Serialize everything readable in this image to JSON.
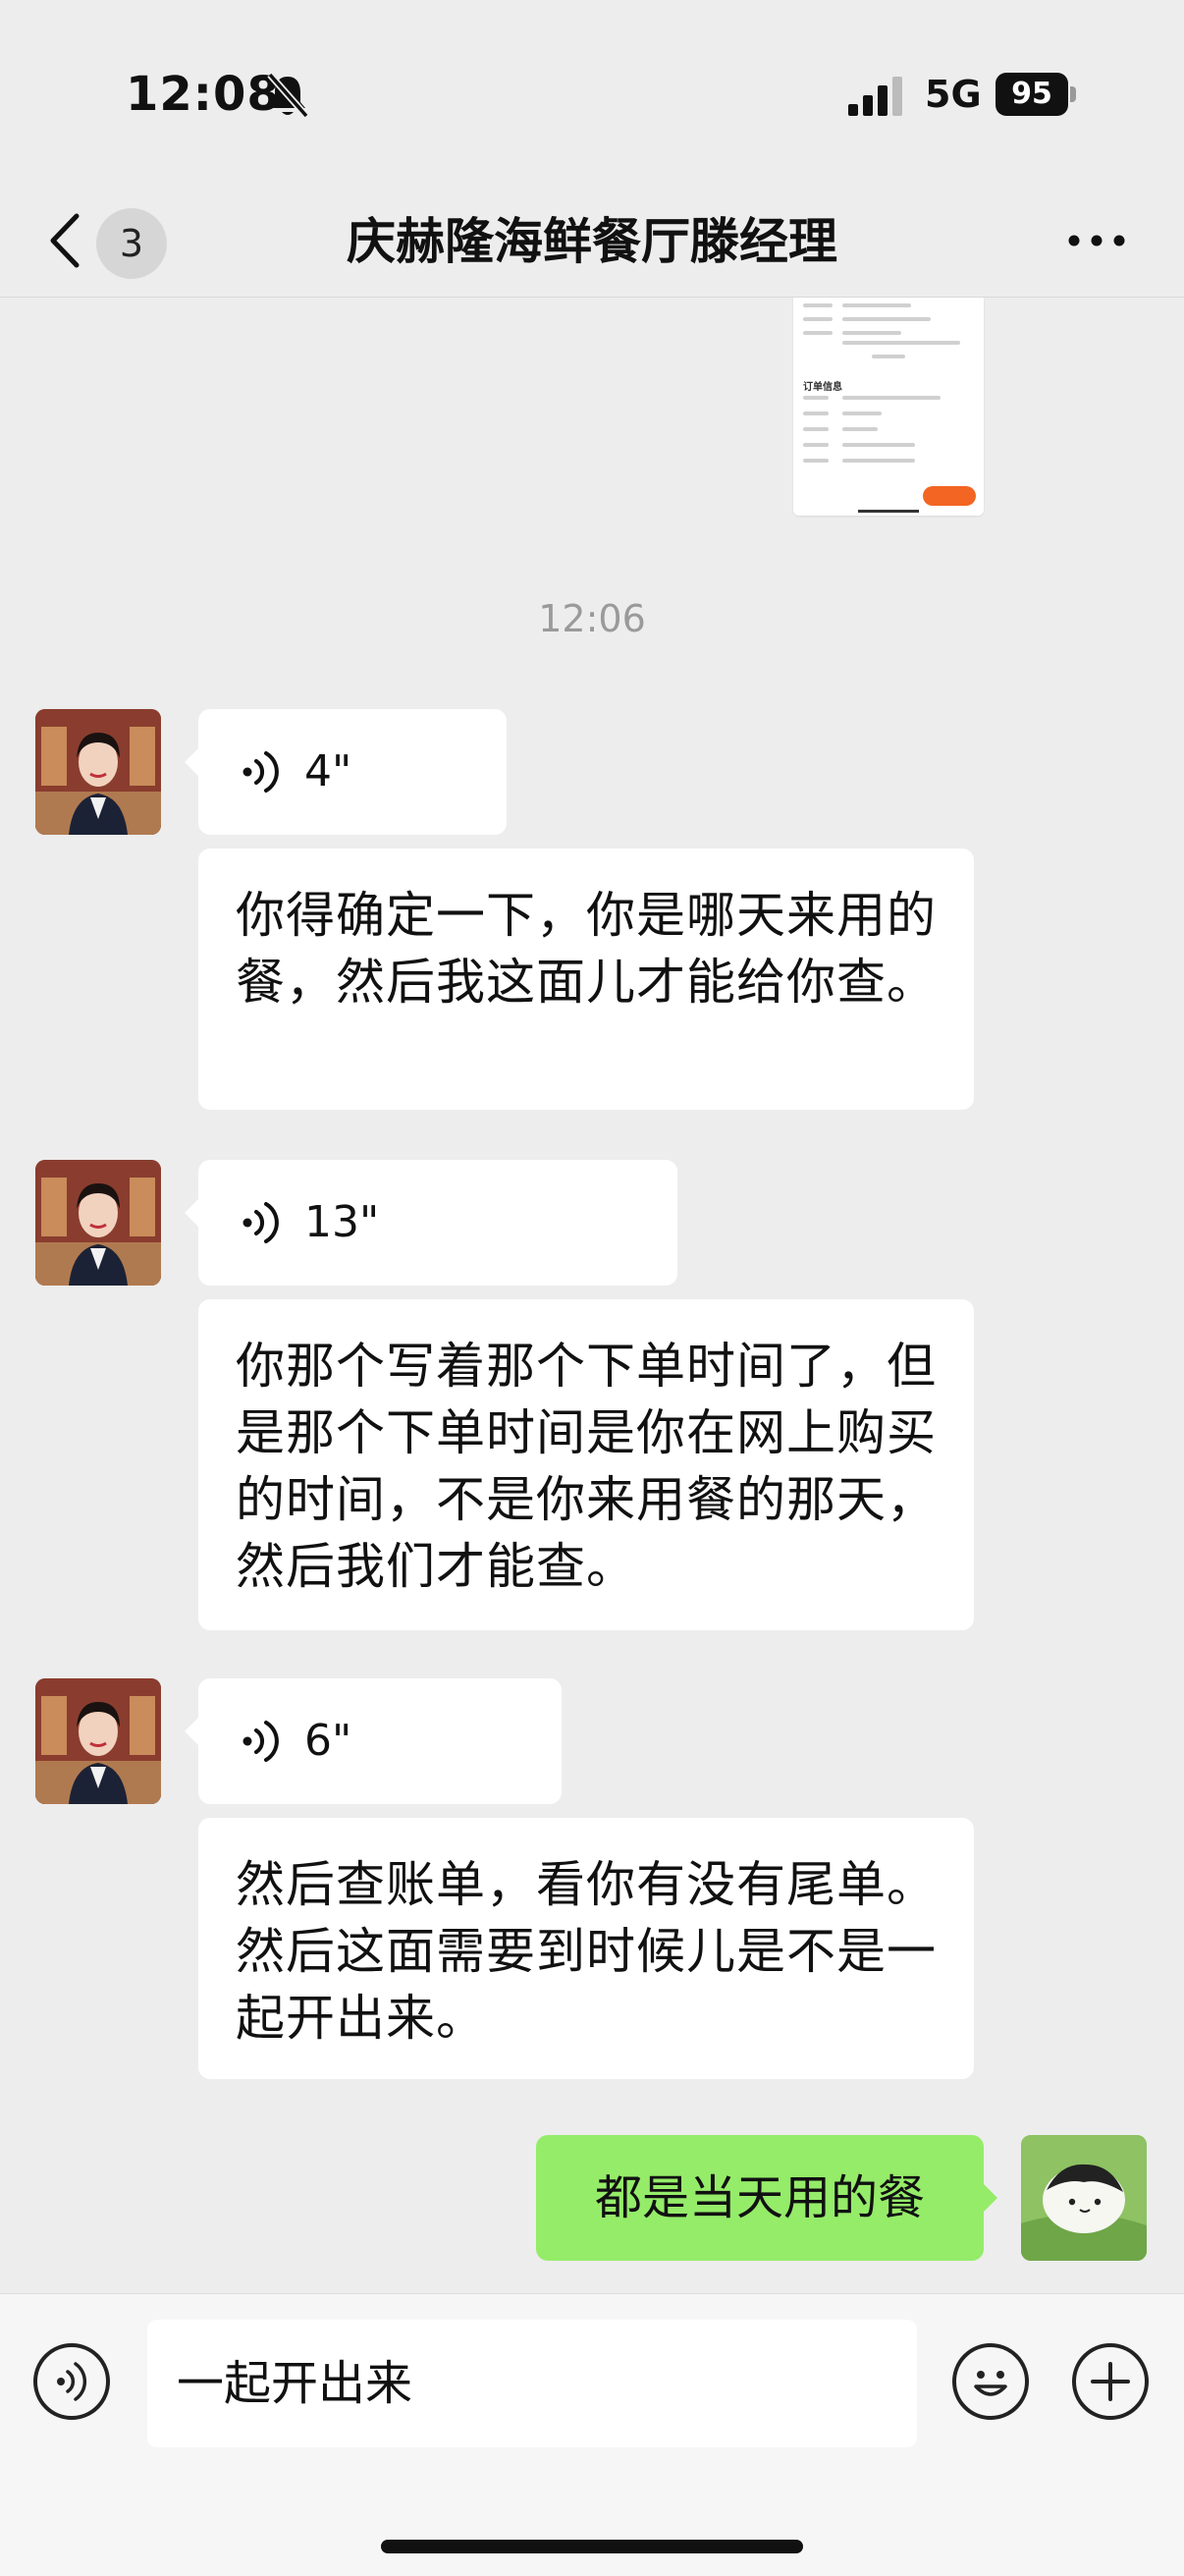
{
  "status_bar": {
    "time": "12:08",
    "network": "5G",
    "battery": "95"
  },
  "nav": {
    "unread_count": "3",
    "title": "庆赫隆海鲜餐厅滕经理"
  },
  "chat": {
    "timestamp": "12:06",
    "messages": [
      {
        "voice_duration": "4\"",
        "transcript": "你得确定一下，你是哪天来用的餐，然后我这面儿才能给你查。"
      },
      {
        "voice_duration": "13\"",
        "transcript": "你那个写着那个下单时间了，但是那个下单时间是你在网上购买的时间，不是你来用餐的那天，然后我们才能查。"
      },
      {
        "voice_duration": "6\"",
        "transcript": "然后查账单，看你有没有尾单。然后这面需要到时候儿是不是一起开出来。"
      }
    ],
    "outgoing": {
      "text": "都是当天用的餐"
    },
    "thumbnail": {
      "section_label": "订单信息"
    }
  },
  "input": {
    "value": "一起开出来"
  },
  "colors": {
    "background": "#ededed",
    "incoming_bubble": "#ffffff",
    "outgoing_bubble": "#95ec69"
  }
}
